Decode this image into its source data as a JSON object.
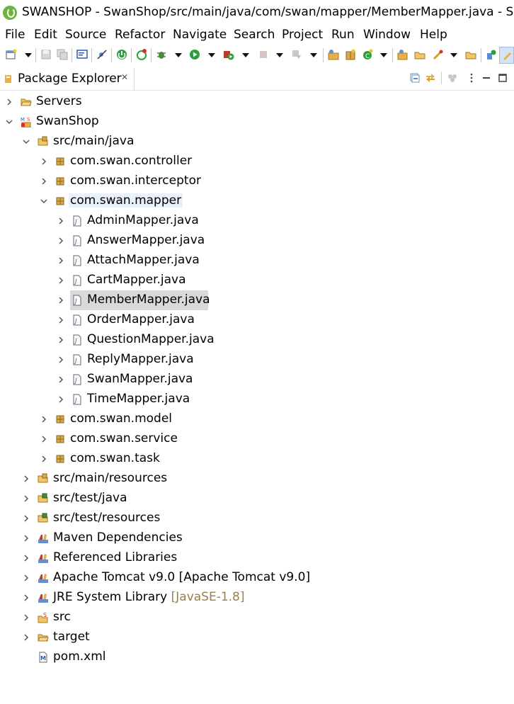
{
  "window": {
    "title": "SWANSHOP - SwanShop/src/main/java/com/swan/mapper/MemberMapper.java - Spr"
  },
  "menu": [
    "File",
    "Edit",
    "Source",
    "Refactor",
    "Navigate",
    "Search",
    "Project",
    "Run",
    "Window",
    "Help"
  ],
  "toolbar": {
    "icons": [
      "new-icon",
      "save-icon",
      "save-all-icon",
      "console-icon",
      "skip-breakpoints-icon",
      "terminate-icon",
      "spring-refresh-icon",
      "debug-icon",
      "run-icon",
      "run-coverage-icon",
      "stop-icon",
      "external-tools-icon",
      "new-java-project-icon",
      "new-package-icon",
      "new-class-icon",
      "open-type-icon",
      "open-task-icon",
      "search-icon",
      "open-perspective-icon",
      "java-perspective-icon"
    ]
  },
  "view": {
    "title": "Package Explorer",
    "close_glyph": "✕"
  },
  "tree": [
    {
      "label": "Servers"
    },
    {
      "label": "SwanShop"
    },
    {
      "label": "src/main/java"
    },
    {
      "label": "com.swan.controller"
    },
    {
      "label": "com.swan.interceptor"
    },
    {
      "label": "com.swan.mapper"
    },
    {
      "label": "AdminMapper.java"
    },
    {
      "label": "AnswerMapper.java"
    },
    {
      "label": "AttachMapper.java"
    },
    {
      "label": "CartMapper.java"
    },
    {
      "label": "MemberMapper.java"
    },
    {
      "label": "OrderMapper.java"
    },
    {
      "label": "QuestionMapper.java"
    },
    {
      "label": "ReplyMapper.java"
    },
    {
      "label": "SwanMapper.java"
    },
    {
      "label": "TimeMapper.java"
    },
    {
      "label": "com.swan.model"
    },
    {
      "label": "com.swan.service"
    },
    {
      "label": "com.swan.task"
    },
    {
      "label": "src/main/resources"
    },
    {
      "label": "src/test/java"
    },
    {
      "label": "src/test/resources"
    },
    {
      "label": "Maven Dependencies"
    },
    {
      "label": "Referenced Libraries"
    },
    {
      "label": "Apache Tomcat v9.0 [Apache Tomcat v9.0]"
    },
    {
      "label": "JRE System Library",
      "decoration": "[JavaSE-1.8]"
    },
    {
      "label": "src"
    },
    {
      "label": "target"
    },
    {
      "label": "pom.xml"
    }
  ]
}
